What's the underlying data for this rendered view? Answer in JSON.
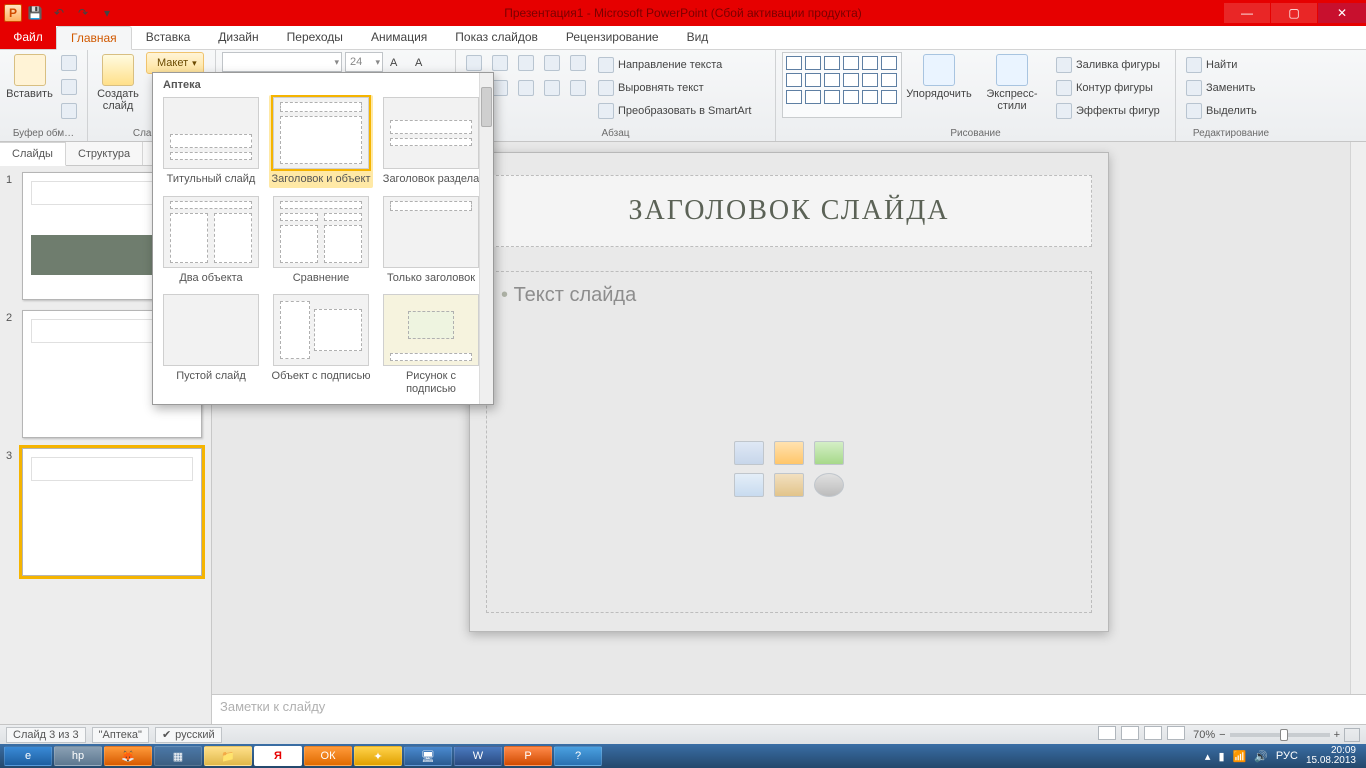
{
  "titlebar": {
    "title": "Презентация1 - Microsoft PowerPoint (Сбой активации продукта)"
  },
  "tabs": {
    "file": "Файл",
    "items": [
      "Главная",
      "Вставка",
      "Дизайн",
      "Переходы",
      "Анимация",
      "Показ слайдов",
      "Рецензирование",
      "Вид"
    ],
    "active": 0
  },
  "ribbon": {
    "clipboard": {
      "paste": "Вставить",
      "label": "Буфер обм…"
    },
    "slides": {
      "new": "Создать\nслайд",
      "layout": "Макет",
      "label": "Слайды"
    },
    "font": {
      "size": "24"
    },
    "paragraph": {
      "textdir": "Направление текста",
      "align": "Выровнять текст",
      "smartart": "Преобразовать в SmartArt",
      "label": "Абзац"
    },
    "drawing": {
      "arrange": "Упорядочить",
      "qstyles": "Экспресс-стили",
      "fill": "Заливка фигуры",
      "outline": "Контур фигуры",
      "effects": "Эффекты фигур",
      "label": "Рисование"
    },
    "editing": {
      "find": "Найти",
      "replace": "Заменить",
      "select": "Выделить",
      "label": "Редактирование"
    }
  },
  "layout_dd": {
    "theme": "Аптека",
    "items": [
      "Титульный слайд",
      "Заголовок и объект",
      "Заголовок раздела",
      "Два объекта",
      "Сравнение",
      "Только заголовок",
      "Пустой слайд",
      "Объект с подписью",
      "Рисунок с подписью"
    ],
    "selected": 1
  },
  "panel": {
    "slides_tab": "Слайды",
    "outline_tab": "Структура",
    "nums": [
      "1",
      "2",
      "3"
    ]
  },
  "slide": {
    "title": "ЗАГОЛОВОК СЛАЙДА",
    "body": "Текст слайда"
  },
  "notes": {
    "placeholder": "Заметки к слайду"
  },
  "status": {
    "slide_of": "Слайд 3 из 3",
    "theme": "\"Аптека\"",
    "lang": "русский",
    "zoom": "70%"
  },
  "tray": {
    "lang": "РУС",
    "time": "20:09",
    "date": "15.08.2013"
  }
}
